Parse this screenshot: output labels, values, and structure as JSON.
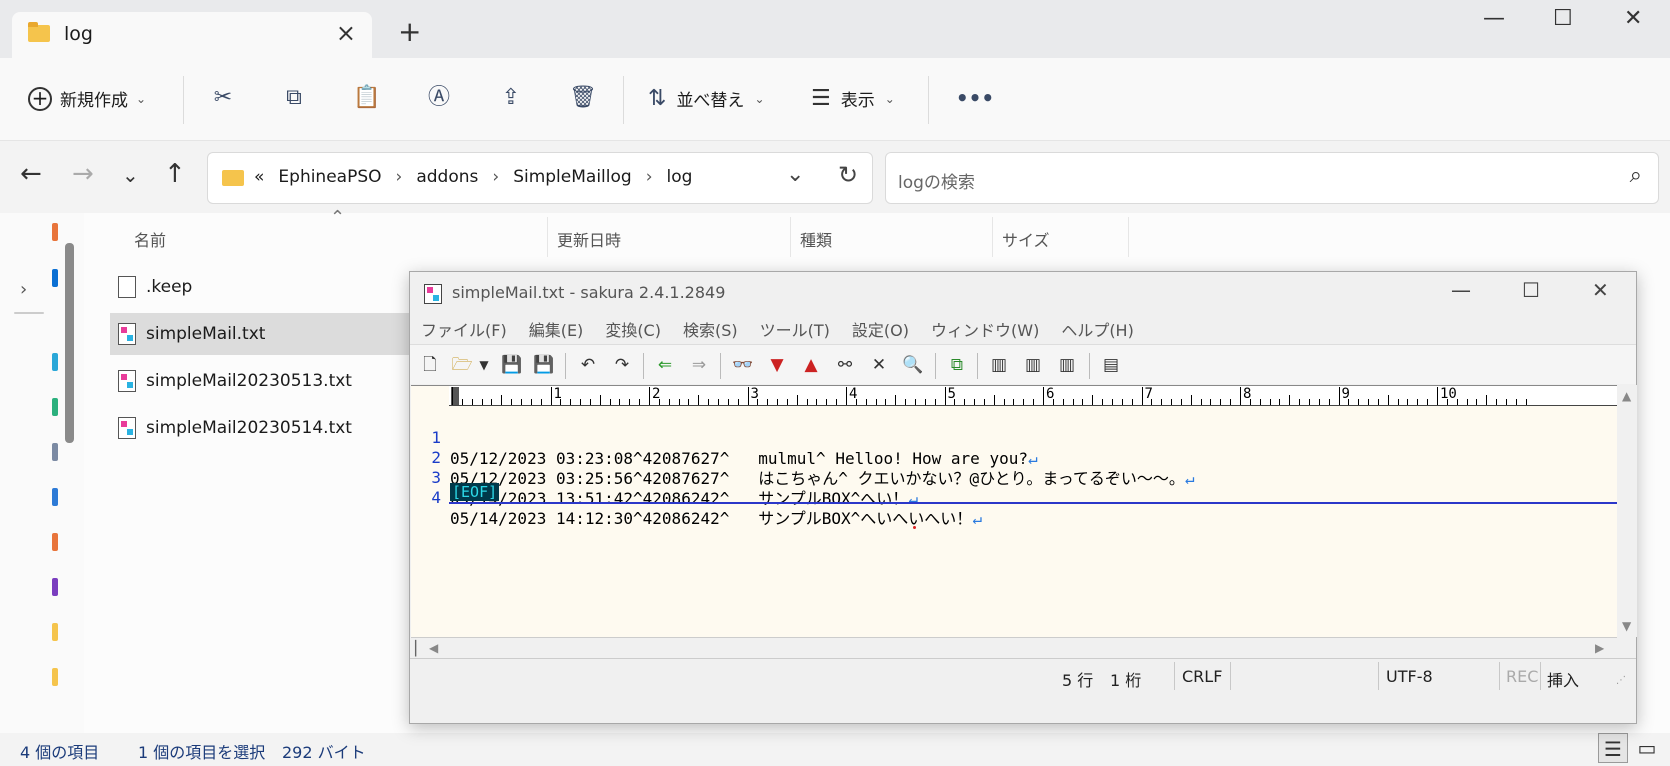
{
  "tab": {
    "title": "log",
    "close_icon": "×",
    "new_tab_icon": "+"
  },
  "window_controls": {
    "minimize": "—",
    "maximize": "☐",
    "close": "✕"
  },
  "toolbar": {
    "new_label": "新規作成",
    "sort_label": "並べ替え",
    "view_label": "表示",
    "more_label": "•••"
  },
  "breadcrumb": {
    "overflow": "«",
    "items": [
      "EphineaPSO",
      "addons",
      "SimpleMaillog",
      "log"
    ],
    "separator": "›"
  },
  "search": {
    "placeholder": "logの検索"
  },
  "columns": {
    "name": "名前",
    "date": "更新日時",
    "type": "種類",
    "size": "サイズ"
  },
  "files": [
    {
      "name": ".keep",
      "selected": false,
      "icon": "blank-file-icon"
    },
    {
      "name": "simpleMail.txt",
      "selected": true,
      "icon": "sakura-text-file-icon"
    },
    {
      "name": "simpleMail20230513.txt",
      "selected": false,
      "icon": "sakura-text-file-icon"
    },
    {
      "name": "simpleMail20230514.txt",
      "selected": false,
      "icon": "sakura-text-file-icon"
    }
  ],
  "status": {
    "item_count": "4 個の項目",
    "selection": "1 個の項目を選択",
    "size": "292 バイト"
  },
  "sakura": {
    "title": "simpleMail.txt - sakura 2.4.1.2849",
    "menu": [
      "ファイル(F)",
      "編集(E)",
      "変換(C)",
      "検索(S)",
      "ツール(T)",
      "設定(O)",
      "ウィンドウ(W)",
      "ヘルプ(H)"
    ],
    "ruler_numbers": [
      "1",
      "2",
      "3",
      "4",
      "5",
      "6",
      "7",
      "8",
      "9",
      "10"
    ],
    "lines": [
      {
        "no": "1",
        "text": "05/12/2023 03:23:08^42087627^   mulmul^ Helloo! How are you?"
      },
      {
        "no": "2",
        "text": "05/12/2023 03:25:56^42087627^   はこちゃん^ クエいかない？@ひとり。まってるぞい〜〜。"
      },
      {
        "no": "3",
        "text": "05/14/2023 13:51:42^42086242^   サンプルBOX^へい！"
      },
      {
        "no": "4",
        "text": "05/14/2023 14:12:30^42086242^   サンプルBOX^へいへいへい！"
      }
    ],
    "eol_mark": "↵",
    "eof_label": "[EOF]",
    "status": {
      "row": "5 行",
      "col": "1 桁",
      "eol": "CRLF",
      "encoding": "UTF-8",
      "rec": "REC",
      "mode": "挿入"
    }
  },
  "colors": {
    "line_number": "#1a3cc8",
    "eol_mark": "#2a7adf",
    "editor_bg": "#fefaf0",
    "eof_bg": "#00394a",
    "eof_fg": "#2cd9e8",
    "cursor_line": "#2b37c9"
  }
}
